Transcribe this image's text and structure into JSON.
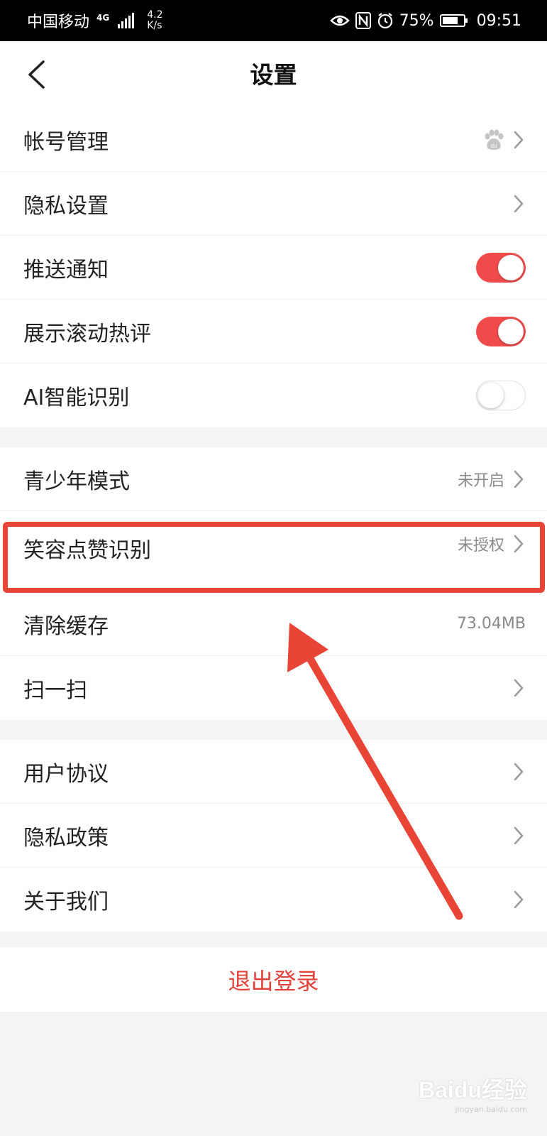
{
  "status_bar": {
    "carrier": "中国移动",
    "network": "4G",
    "speed_value": "4.2",
    "speed_unit": "K/s",
    "battery": "75%",
    "time": "09:51"
  },
  "nav": {
    "title": "设置"
  },
  "group1": [
    {
      "label": "帐号管理",
      "right": "baidu-paw-icon + chevron"
    },
    {
      "label": "隐私设置"
    },
    {
      "label": "推送通知",
      "toggle": true
    },
    {
      "label": "展示滚动热评",
      "toggle": true
    },
    {
      "label": "AI智能识别",
      "toggle": false
    }
  ],
  "group2": [
    {
      "label": "青少年模式",
      "value": "未开启"
    },
    {
      "label": "笑容点赞识别",
      "value": "未授权"
    },
    {
      "label": "清除缓存",
      "value": "73.04MB"
    },
    {
      "label": "扫一扫"
    }
  ],
  "group3": [
    {
      "label": "用户协议"
    },
    {
      "label": "隐私政策"
    },
    {
      "label": "关于我们"
    }
  ],
  "logout_label": "退出登录",
  "watermark": {
    "logo": "Baidu经验",
    "url": "jingyan.baidu.com"
  },
  "colors": {
    "accent": "#ef4b4b",
    "annotation": "#e84537",
    "logout": "#e4413a"
  }
}
